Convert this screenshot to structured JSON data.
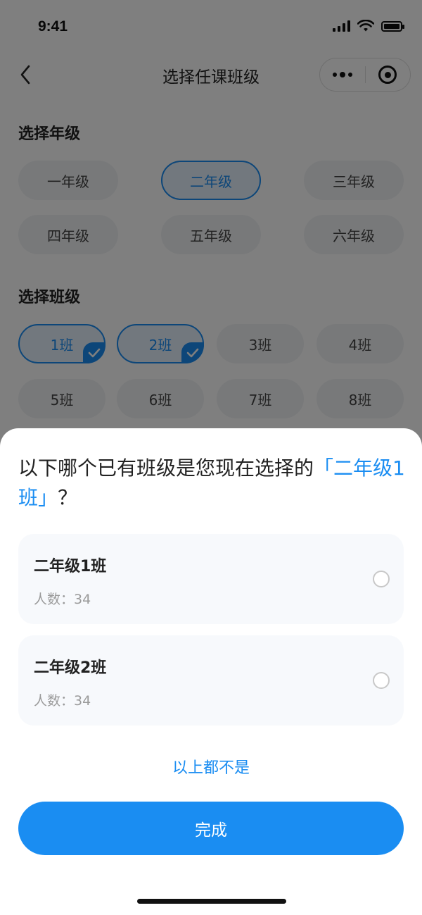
{
  "status_bar": {
    "time": "9:41"
  },
  "nav": {
    "title": "选择任课班级"
  },
  "grade_section": {
    "label": "选择年级",
    "grades": [
      "一年级",
      "二年级",
      "三年级",
      "四年级",
      "五年级",
      "六年级"
    ],
    "selected": "二年级"
  },
  "class_section": {
    "label": "选择班级",
    "classes": [
      "1班",
      "2班",
      "3班",
      "4班",
      "5班",
      "6班",
      "7班",
      "8班"
    ],
    "selected": [
      "1班",
      "2班"
    ]
  },
  "sheet": {
    "question_prefix": "以下哪个已有班级是您现在选择的",
    "question_highlight": "「二年级1班」",
    "question_suffix": "？",
    "options": [
      {
        "name": "二年级1班",
        "count": "人数：34"
      },
      {
        "name": "二年级2班",
        "count": "人数：34"
      }
    ],
    "none_label": "以上都不是",
    "done_label": "完成"
  },
  "colors": {
    "accent": "#1a8df2",
    "chip_bg": "#f0f2f5",
    "option_bg": "#f7f9fc"
  }
}
